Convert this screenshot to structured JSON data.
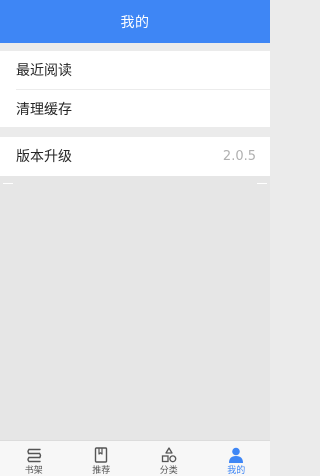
{
  "colors": {
    "accent": "#3e86f5",
    "background": "#ebebeb",
    "text": "#262626",
    "muted": "#b0b0b0"
  },
  "header": {
    "title": "我的"
  },
  "menu": {
    "recent_reading": "最近阅读",
    "clear_cache": "清理缓存",
    "version_upgrade": "版本升级",
    "version_number": "2.0.5"
  },
  "tabbar": {
    "items": [
      {
        "label": "书架",
        "icon": "bookshelf-icon",
        "active": false
      },
      {
        "label": "推荐",
        "icon": "bookmark-book-icon",
        "active": false
      },
      {
        "label": "分类",
        "icon": "shapes-category-icon",
        "active": false
      },
      {
        "label": "我的",
        "icon": "person-icon",
        "active": true
      }
    ]
  }
}
